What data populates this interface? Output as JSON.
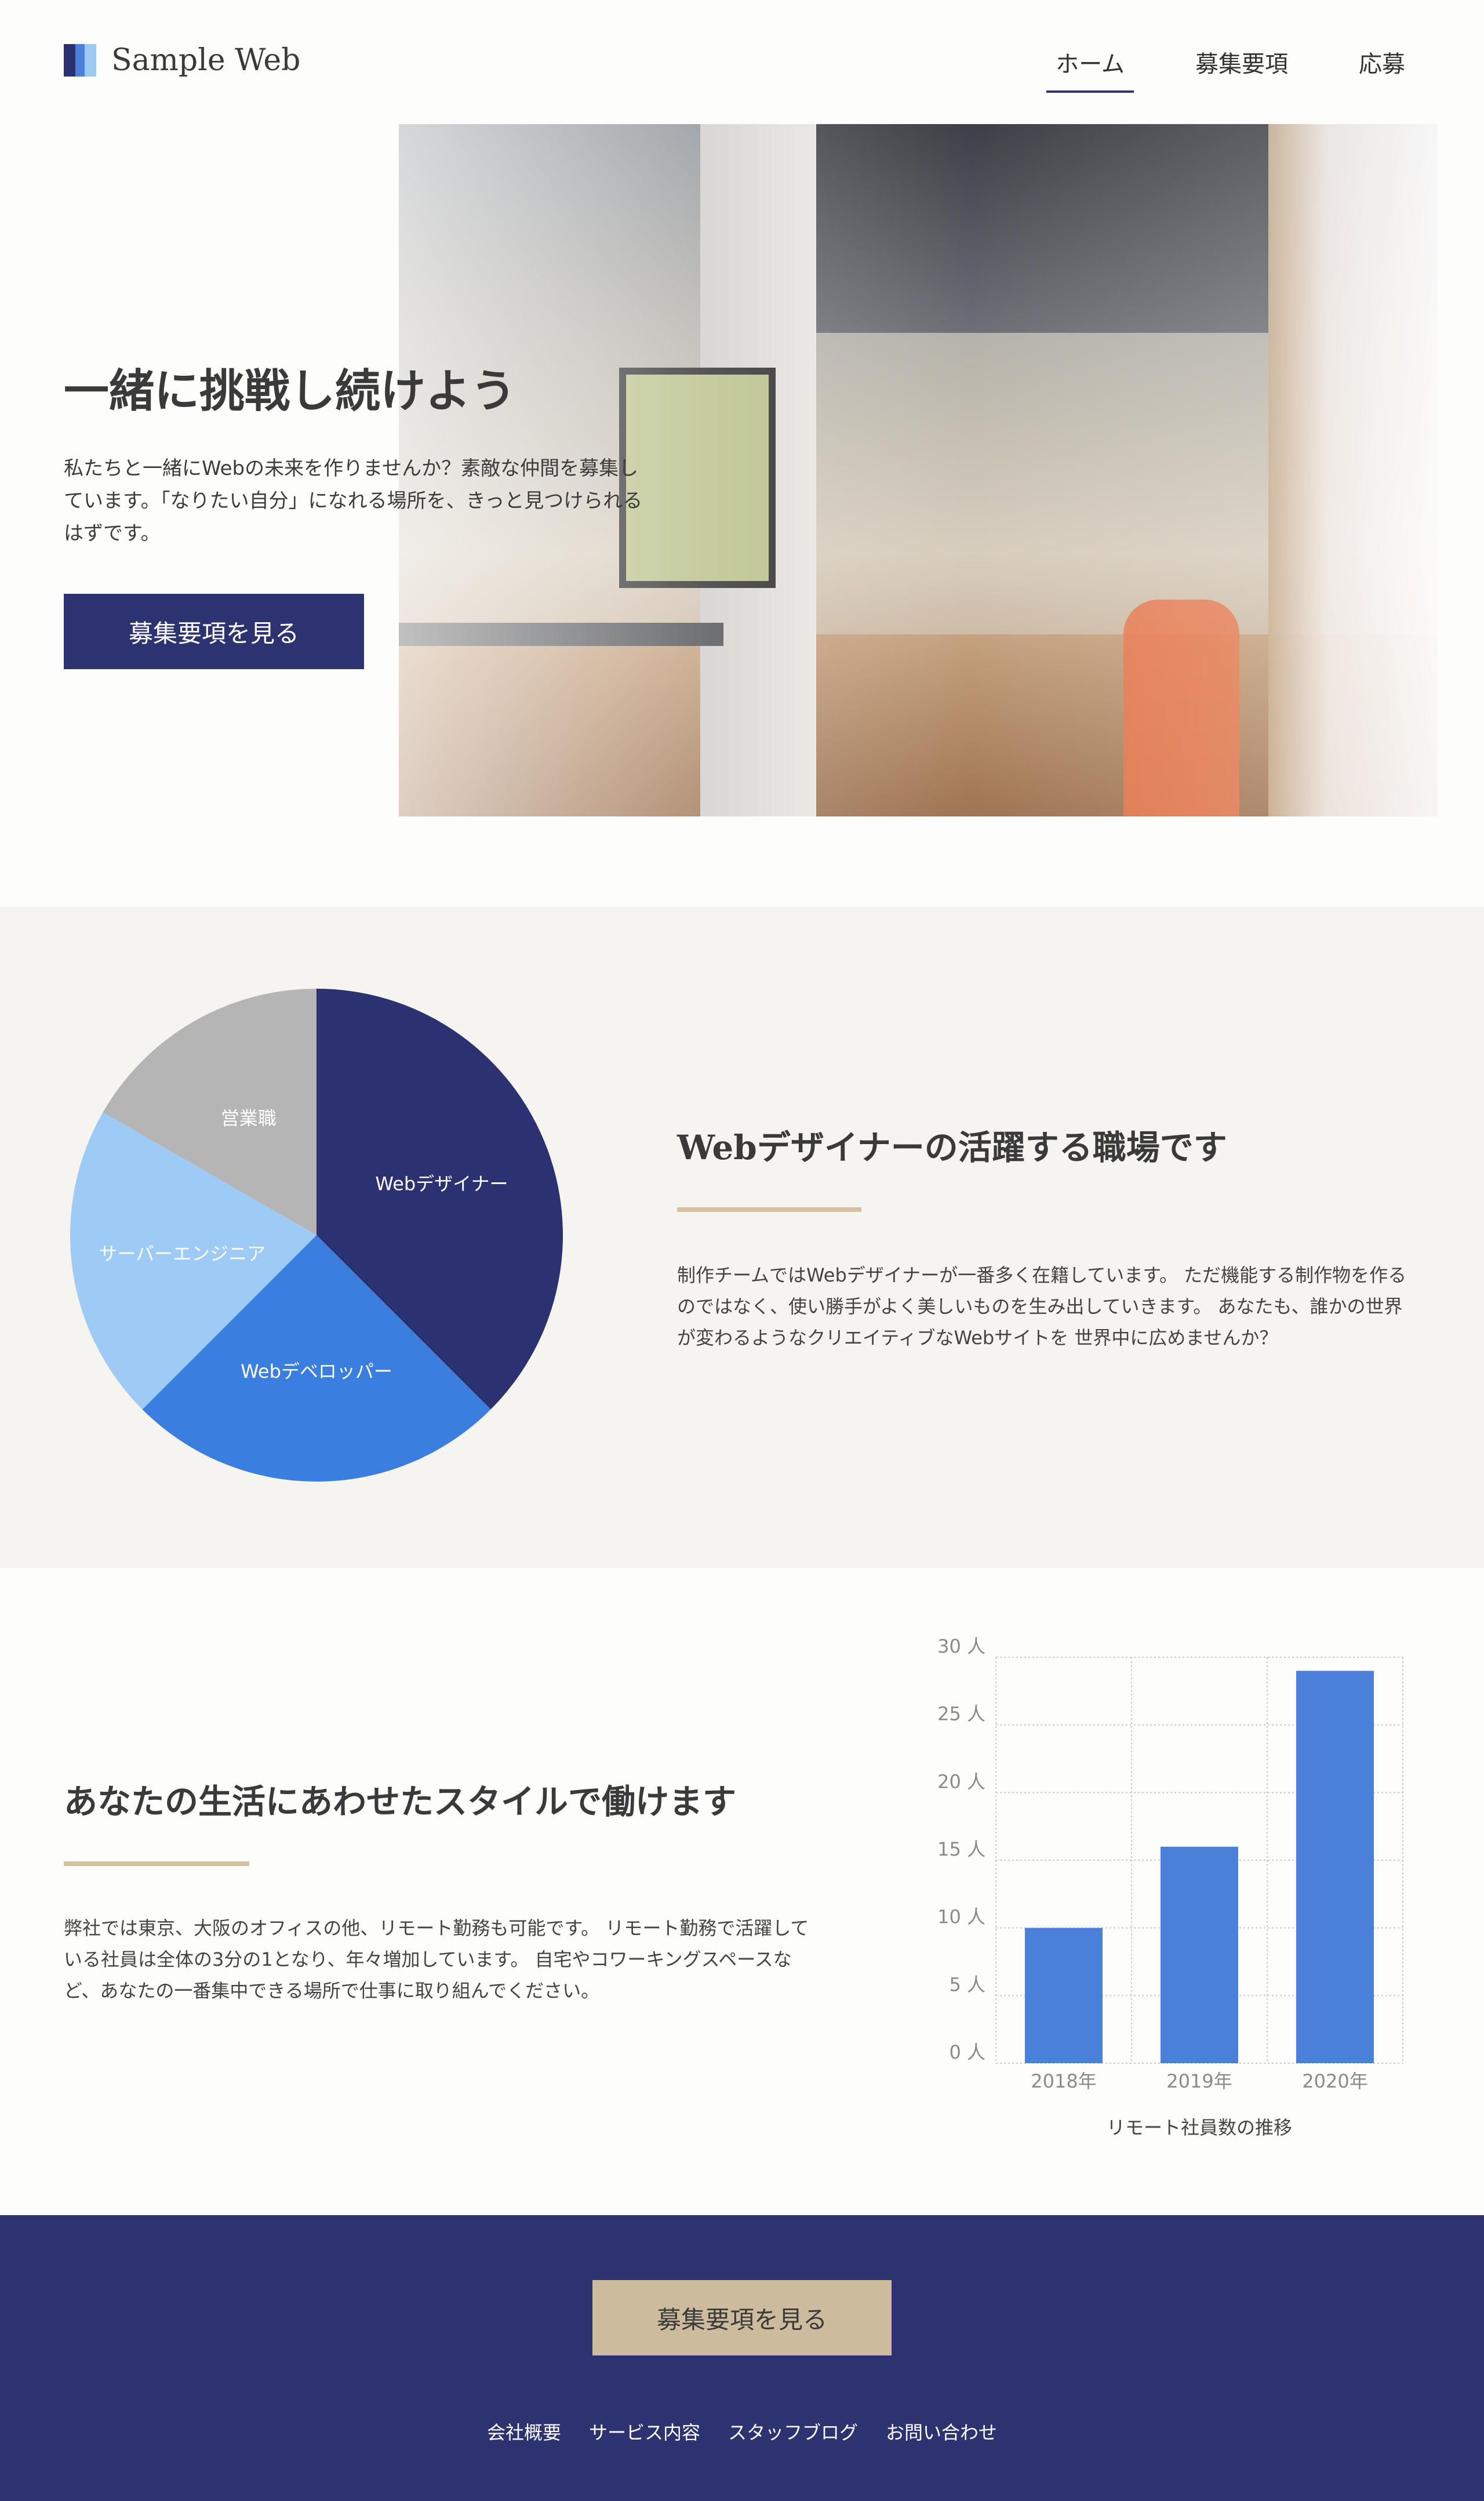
{
  "header": {
    "logo_text": "Sample Web",
    "nav": [
      {
        "label": "ホーム",
        "active": true
      },
      {
        "label": "募集要項",
        "active": false
      },
      {
        "label": "応募",
        "active": false
      }
    ]
  },
  "hero": {
    "title": "一緒に挑戦し続けよう",
    "text": "私たちと一緒にWebの未来を作りませんか？素敵な仲間を募集しています。「なりたい自分」になれる場所を、きっと見つけられるはずです。",
    "button": "募集要項を見る"
  },
  "section_roles": {
    "title": "Webデザイナーの活躍する職場です",
    "text": "制作チームではWebデザイナーが一番多く在籍しています。 ただ機能する制作物を作るのではなく、使い勝手がよく美しいものを生み出していきます。 あなたも、誰かの世界が変わるようなクリエイティブなWebサイトを 世界中に広めませんか？"
  },
  "section_remote": {
    "title": "あなたの生活にあわせたスタイルで働けます",
    "text": "弊社では東京、大阪のオフィスの他、リモート勤務も可能です。 リモート勤務で活躍している社員は全体の3分の1となり、年々増加しています。 自宅やコワーキングスペースなど、あなたの一番集中できる場所で仕事に取り組んでください。"
  },
  "footer": {
    "button": "募集要項を見る",
    "links": [
      "会社概要",
      "サービス内容",
      "スタッフブログ",
      "お問い合わせ"
    ]
  },
  "colors": {
    "navy": "#2d3270",
    "accent_beige": "#cdbb9d",
    "bar_blue": "#4a80d9"
  },
  "chart_data": [
    {
      "type": "pie",
      "categories": [
        "Webデザイナー",
        "Webデベロッパー",
        "サーバーエンジニア",
        "営業職"
      ],
      "values": [
        37.5,
        25,
        20.8,
        16.7
      ],
      "colors": [
        "#2c3172",
        "#3a7ee0",
        "#9ecbf5",
        "#b5b5b5"
      ],
      "legend": "none"
    },
    {
      "type": "bar",
      "categories": [
        "2018年",
        "2019年",
        "2020年"
      ],
      "values": [
        10,
        16,
        29
      ],
      "xlabel": "リモート社員数の推移",
      "ylabel": "",
      "ylim": [
        0,
        30
      ],
      "yticks": [
        "0 人",
        "5 人",
        "10 人",
        "15 人",
        "20 人",
        "25 人",
        "30 人"
      ],
      "grid": true,
      "color": "#4a80d9"
    }
  ]
}
